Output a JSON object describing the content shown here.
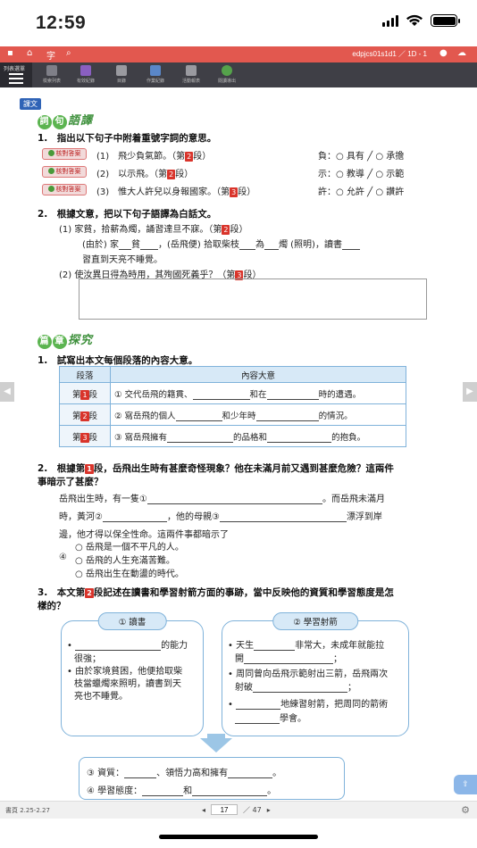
{
  "status_bar": {
    "time": "12:59"
  },
  "top_bar": {
    "crumb": "edpjcs01s1d1 ／ 1D - 1"
  },
  "toolbar": {
    "menu_label": "列表選單",
    "tools": [
      "檢索列表",
      "有效紀錄",
      "目錄",
      "作業紀錄",
      "活動報表",
      "閱讀導出"
    ]
  },
  "lesson": {
    "tag": "課文",
    "sec1_title": {
      "b1": "詞",
      "b2": "句",
      "rest": "語譯"
    },
    "q1": "1.　指出以下句子中附着重號字詞的意思。",
    "answer_btn": "核對答案",
    "q1_items": [
      {
        "num": "(1)",
        "text": "飛少負氣節。（第",
        "para": "2",
        "tail": "段）",
        "word": "負：",
        "o1": "○ 具有",
        "sep": "╱",
        "o2": "○ 承擔"
      },
      {
        "num": "(2)",
        "text": "以示飛。（第",
        "para": "2",
        "tail": "段）",
        "word": "示：",
        "o1": "○ 教導",
        "sep": "╱",
        "o2": "○ 示範"
      },
      {
        "num": "(3)",
        "text": "惟大人許兒以身報國家。（第",
        "para": "3",
        "tail": "段）",
        "word": "許：",
        "o1": "○ 允許",
        "sep": "╱",
        "o2": "○ 讚許"
      }
    ],
    "q2": "2.　根據文意，把以下句子語譯為白話文。",
    "q2_1": {
      "num": "(1)",
      "text": "家貧，拾薪為燭，誦習達旦不寐。（第",
      "para": "2",
      "tail": "段）"
    },
    "q2_1_ans": {
      "a": "(由於) 家",
      "b": "貧",
      "c": "，(岳飛便) 拾取柴枝",
      "d": "為",
      "e": "燭 (照明)，讀書",
      "f": "習直到天亮不睡覺。"
    },
    "q2_2": {
      "num": "(2)",
      "text": "使汝異日得為時用，其殉國死義乎？（第",
      "para": "3",
      "tail": "段）"
    },
    "sec2_title": {
      "b1": "篇",
      "b2": "章",
      "rest": "探究"
    },
    "q3": "1.　試寫出本文每個段落的內容大意。",
    "table": {
      "headers": [
        "段落",
        "內容大意"
      ],
      "rows": [
        {
          "p1": "第",
          "p2": "1",
          "p3": "段",
          "c1": "① 交代岳飛的籍貫、",
          "c2": "和在",
          "c3": "時的遭遇。"
        },
        {
          "p1": "第",
          "p2": "2",
          "p3": "段",
          "c1": "② 寫岳飛的個人",
          "c2": "和少年時",
          "c3": "的情況。"
        },
        {
          "p1": "第",
          "p2": "3",
          "p3": "段",
          "c1": "③ 寫岳飛擁有",
          "c2": "的品格和",
          "c3": "的抱負。"
        }
      ]
    },
    "q4_a": "2.　根據第",
    "q4_para": "1",
    "q4_b": "段，岳飛出生時有甚麼奇怪現象？他在未滿月前又遇到甚麼危險？這兩件",
    "q4_c": "事暗示了甚麼？",
    "q4_l1a": "岳飛出生時，有一隻①",
    "q4_l1b": "。而岳飛未滿月",
    "q4_l2a": "時，黃河②",
    "q4_l2b": "，他的母親③",
    "q4_l2c": "漂浮到岸",
    "q4_l3": "邊，他才得以保全性命。這兩件事都暗示了",
    "q4_opts": [
      "○ 岳飛是一個不平凡的人。",
      "○ 岳飛的人生充滿苦難。",
      "○ 岳飛出生在動盪的時代。"
    ],
    "q4_num": "④",
    "q5_a": "3.　本文第",
    "q5_para": "2",
    "q5_b": "段記述在讀書和學習射箭方面的事跡，當中反映他的資質和學習態度是怎",
    "q5_c": "樣的？",
    "box1": {
      "head": "① 讀書",
      "l1": "的能力",
      "l2": "很強；",
      "l3": "由於家境貧困，他便拾取柴",
      "l4": "枝當蠟燭來照明，讀書到天",
      "l5": "亮也不睡覺。"
    },
    "box2": {
      "head": "② 學習射箭",
      "l1a": "天生",
      "l1b": "非常大，未成年就能拉",
      "l2a": "開",
      "l2b": "；",
      "l3": "周同曾向岳飛示範射出三箭，岳飛兩次",
      "l4a": "射破",
      "l4b": "；",
      "l5": "地練習射箭，把周同的箭術",
      "l6": "學會。"
    },
    "box3": {
      "l1a": "③ 資質：",
      "l1b": "、領悟力高和擁有",
      "l1c": "。",
      "l2a": "④ 學習態度：",
      "l2b": "和",
      "l2c": "。"
    }
  },
  "bottom_bar": {
    "pages": "書頁 2.25-2.27",
    "prev": "◂",
    "current": "17",
    "total": "／ 47",
    "next": "▸"
  }
}
